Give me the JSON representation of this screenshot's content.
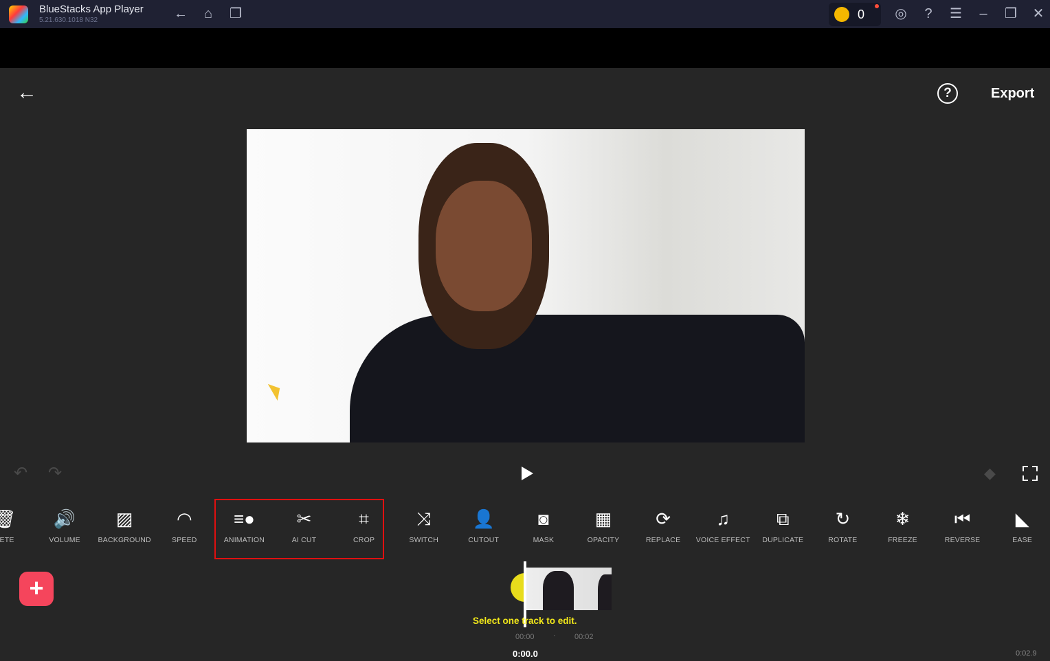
{
  "titlebar": {
    "app_name": "BlueStacks App Player",
    "version": "5.21.630.1018  N32",
    "coins": "0"
  },
  "header": {
    "export_label": "Export"
  },
  "toolbar": [
    {
      "label": "LETE",
      "icon": "trash-icon",
      "glyph": "🗑"
    },
    {
      "label": "VOLUME",
      "icon": "volume-icon",
      "glyph": "🔊"
    },
    {
      "label": "BACKGROUND",
      "icon": "background-icon",
      "glyph": "▨"
    },
    {
      "label": "SPEED",
      "icon": "speed-icon",
      "glyph": "◠"
    },
    {
      "label": "ANIMATION",
      "icon": "animation-icon",
      "glyph": "≡●"
    },
    {
      "label": "AI CUT",
      "icon": "ai-cut-icon",
      "glyph": "✂"
    },
    {
      "label": "CROP",
      "icon": "crop-icon",
      "glyph": "⌗"
    },
    {
      "label": "SWITCH",
      "icon": "shuffle-icon",
      "glyph": "⤨"
    },
    {
      "label": "CUTOUT",
      "icon": "cutout-icon",
      "glyph": "👤"
    },
    {
      "label": "MASK",
      "icon": "mask-icon",
      "glyph": "◙"
    },
    {
      "label": "OPACITY",
      "icon": "opacity-icon",
      "glyph": "▦"
    },
    {
      "label": "REPLACE",
      "icon": "replace-icon",
      "glyph": "⟳"
    },
    {
      "label": "VOICE EFFECT",
      "icon": "voice-effect-icon",
      "glyph": "♫"
    },
    {
      "label": "DUPLICATE",
      "icon": "duplicate-icon",
      "glyph": "⧉"
    },
    {
      "label": "ROTATE",
      "icon": "rotate-icon",
      "glyph": "↻"
    },
    {
      "label": "FREEZE",
      "icon": "freeze-icon",
      "glyph": "❄"
    },
    {
      "label": "REVERSE",
      "icon": "reverse-icon",
      "glyph": "⏮"
    },
    {
      "label": "EASE",
      "icon": "ease-icon",
      "glyph": "◣"
    }
  ],
  "timeline": {
    "hint": "Select one track to edit.",
    "tick_start": "00:00",
    "tick_dot": "·",
    "tick_end": "00:02",
    "current_time": "0:00.0",
    "duration": "0:02.9"
  },
  "colors": {
    "highlight": "#e01010",
    "add_button": "#f5455c",
    "hint": "#f2e81a"
  }
}
